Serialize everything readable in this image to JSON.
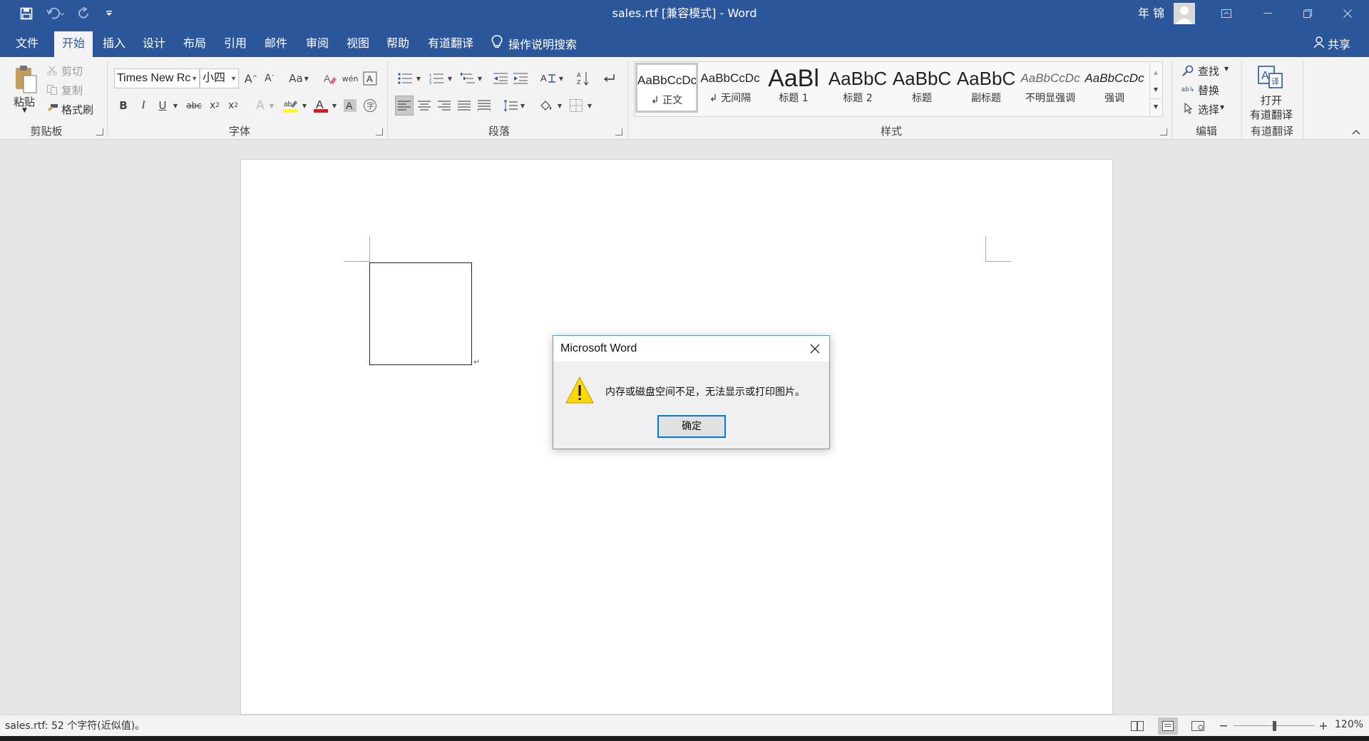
{
  "titlebar": {
    "doc_title": "sales.rtf [兼容模式]  -  Word",
    "user_name": "年 锦",
    "colors": {
      "brand": "#2b579a"
    },
    "icons": [
      "save-icon",
      "undo-icon",
      "redo-icon",
      "customize-qat-icon",
      "ribbon-display-icon",
      "minimize-icon",
      "restore-icon",
      "close-icon"
    ]
  },
  "tabs": {
    "items": [
      "文件",
      "开始",
      "插入",
      "设计",
      "布局",
      "引用",
      "邮件",
      "审阅",
      "视图",
      "帮助",
      "有道翻译"
    ],
    "active": "开始",
    "tell_me": "操作说明搜索",
    "share": "共享"
  },
  "ribbon": {
    "clipboard": {
      "paste": "粘贴",
      "cut": "剪切",
      "copy": "复制",
      "format_painter": "格式刷",
      "label": "剪贴板"
    },
    "font": {
      "font_name": "Times New Rc",
      "font_size": "小四",
      "change_case": "Aa",
      "label": "字体"
    },
    "paragraph": {
      "label": "段落"
    },
    "styles": {
      "items": [
        {
          "sample": "AaBbCcDc",
          "name": "↲ 正文"
        },
        {
          "sample": "AaBbCcDc",
          "name": "↲ 无间隔"
        },
        {
          "sample": "AaBl",
          "name": "标题 1"
        },
        {
          "sample": "AaBbC",
          "name": "标题 2"
        },
        {
          "sample": "AaBbC",
          "name": "标题"
        },
        {
          "sample": "AaBbC",
          "name": "副标题"
        },
        {
          "sample": "AaBbCcDc",
          "name": "不明显强调"
        },
        {
          "sample": "AaBbCcDc",
          "name": "强调"
        }
      ],
      "label": "样式"
    },
    "editing": {
      "find": "查找",
      "replace": "替换",
      "select": "选择",
      "label": "编辑"
    },
    "youdao": {
      "open_line1": "打开",
      "open_line2": "有道翻译",
      "label": "有道翻译"
    }
  },
  "dialog": {
    "title": "Microsoft Word",
    "message": "内存或磁盘空间不足，无法显示或打印图片。",
    "ok_label": "确定"
  },
  "statusbar": {
    "text": "sales.rtf: 52 个字符(近似值)。",
    "zoom": "120%"
  }
}
